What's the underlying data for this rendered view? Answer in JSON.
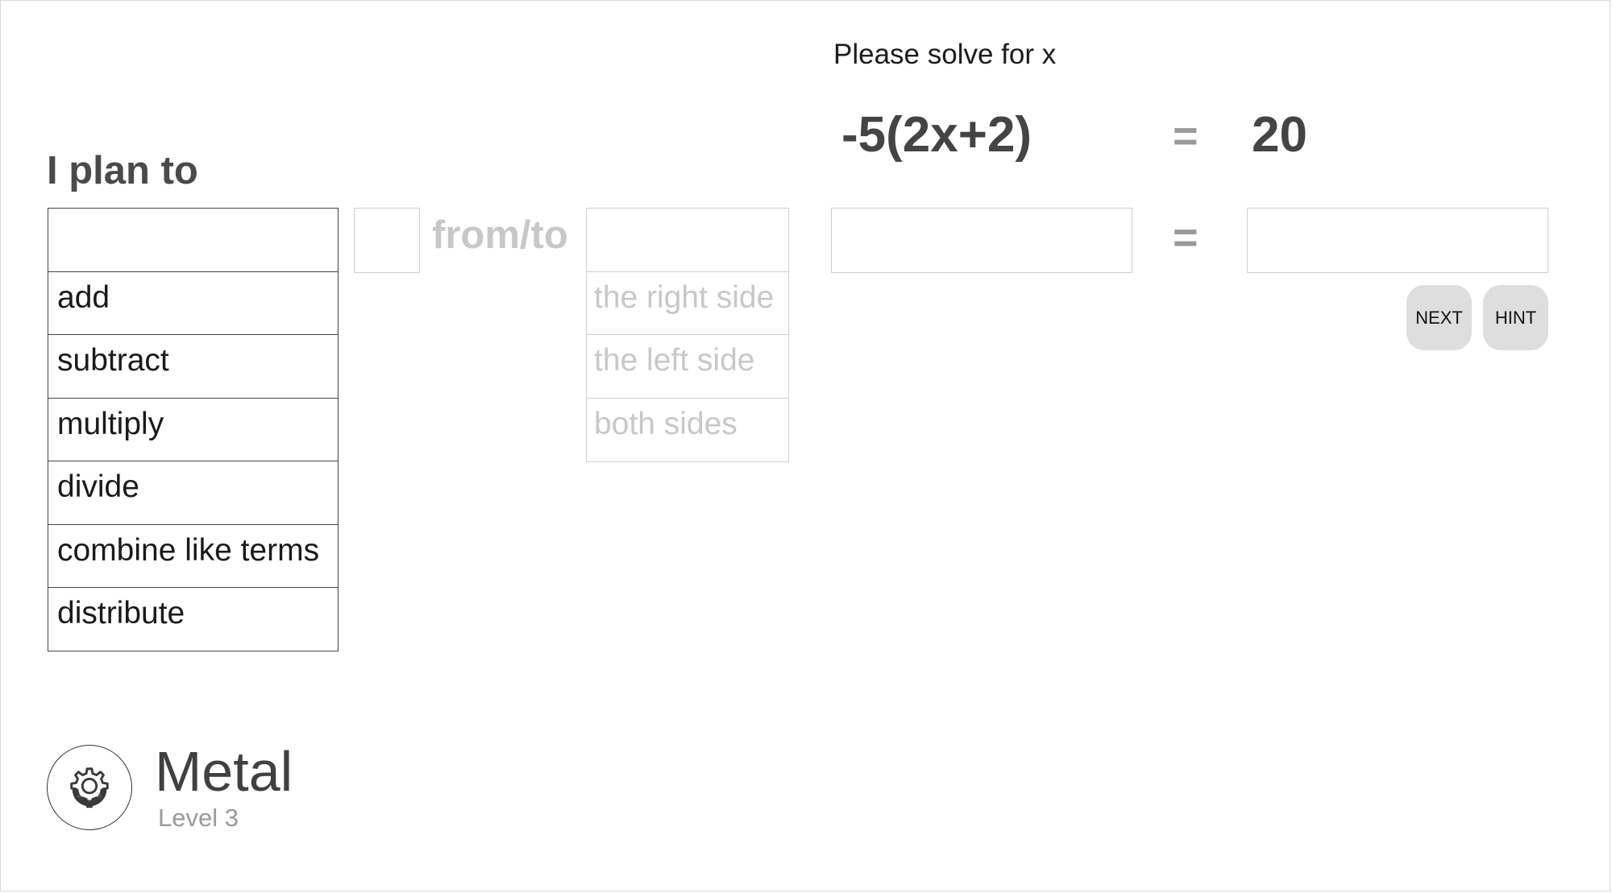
{
  "problem": {
    "instruction": "Please solve for x",
    "left_side": "-5(2x+2)",
    "equals": "=",
    "right_side": "20"
  },
  "plan": {
    "label": "I plan to",
    "selected_operation": "",
    "operations": [
      "add",
      "subtract",
      "multiply",
      "divide",
      "combine like terms",
      "distribute"
    ],
    "number_value": "",
    "connector": "from/to",
    "selected_side": "",
    "sides": [
      "the right side",
      "the left side",
      "both sides"
    ]
  },
  "equation": {
    "left_value": "",
    "equals": "=",
    "right_value": ""
  },
  "buttons": {
    "next": "NEXT",
    "hint": "HINT"
  },
  "badge": {
    "icon": "gear-icon",
    "title": "Metal",
    "subtitle": "Level 3"
  }
}
